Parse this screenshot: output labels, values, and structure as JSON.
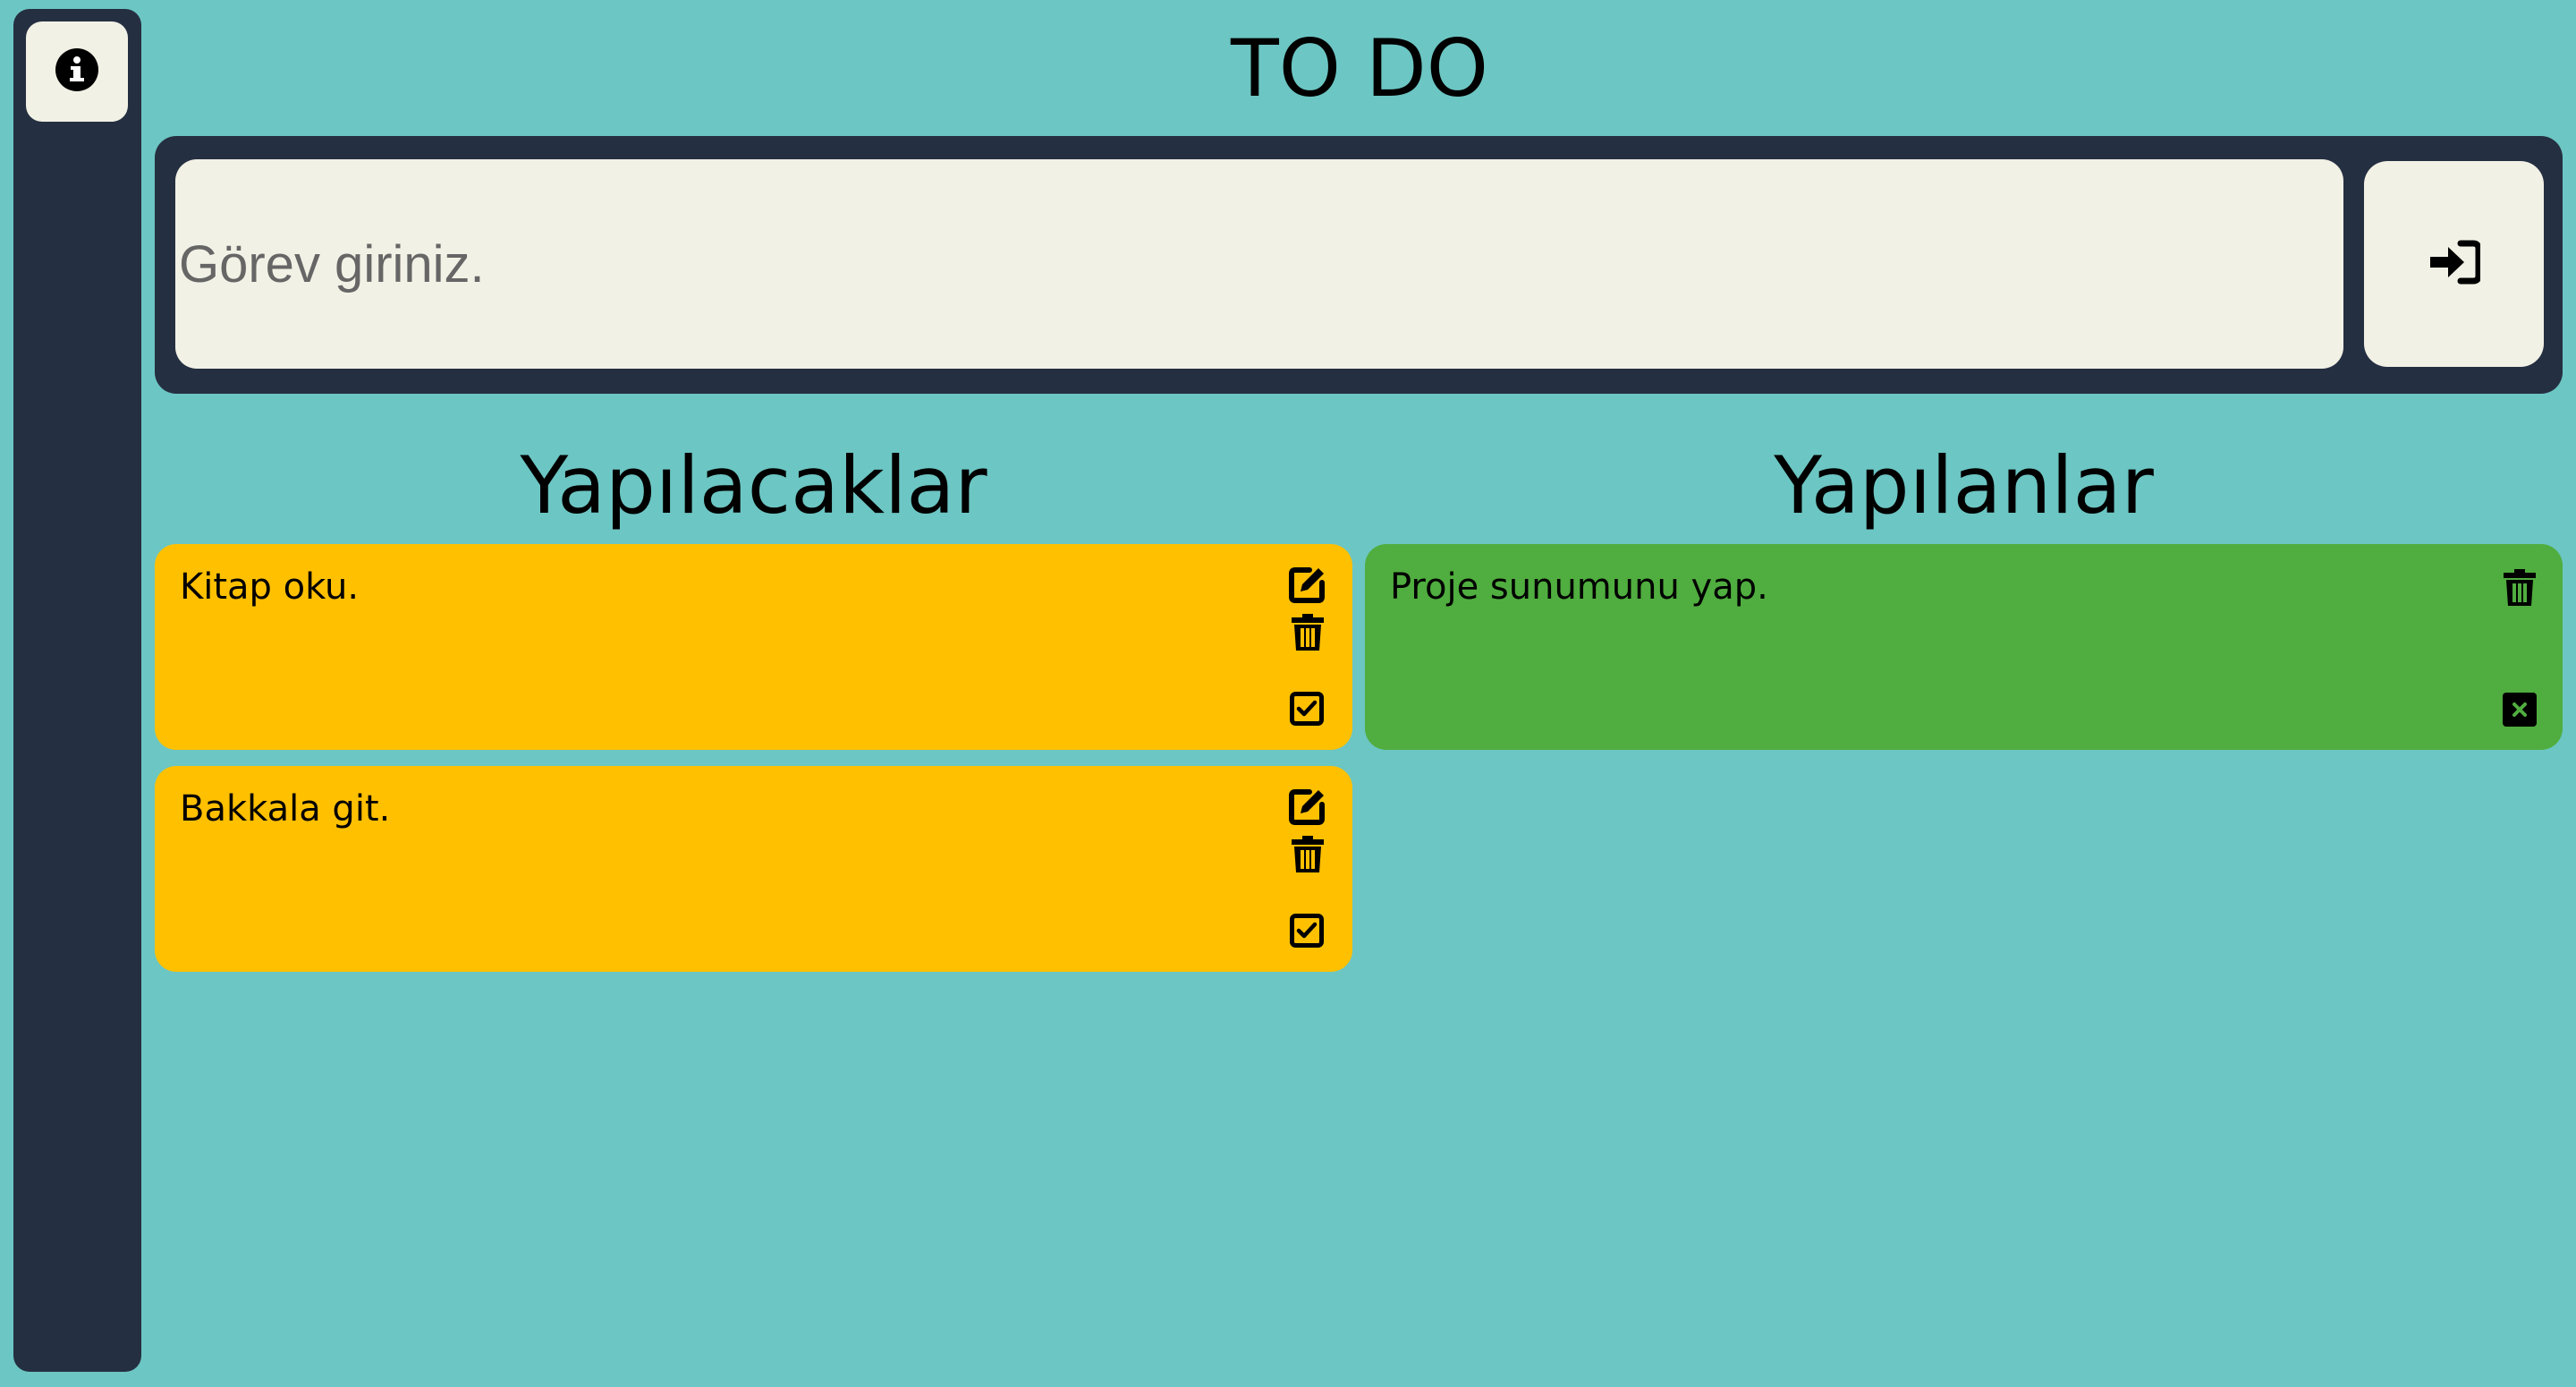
{
  "app": {
    "title": "TO DO"
  },
  "sidebar": {
    "info_icon": "info-circle-icon"
  },
  "input": {
    "placeholder": "Görev giriniz.",
    "value": "",
    "submit_icon": "sign-in-arrow-icon"
  },
  "columns": {
    "todo": {
      "heading": "Yapılacaklar",
      "items": [
        {
          "text": "Kitap oku."
        },
        {
          "text": "Bakkala git."
        }
      ]
    },
    "done": {
      "heading": "Yapılanlar",
      "items": [
        {
          "text": "Proje sunumunu yap."
        }
      ]
    }
  },
  "colors": {
    "background": "#6cc6c3",
    "panel": "#252f42",
    "light": "#f2f1e5",
    "todo_card": "#ffc000",
    "done_card": "#50ad3f"
  }
}
